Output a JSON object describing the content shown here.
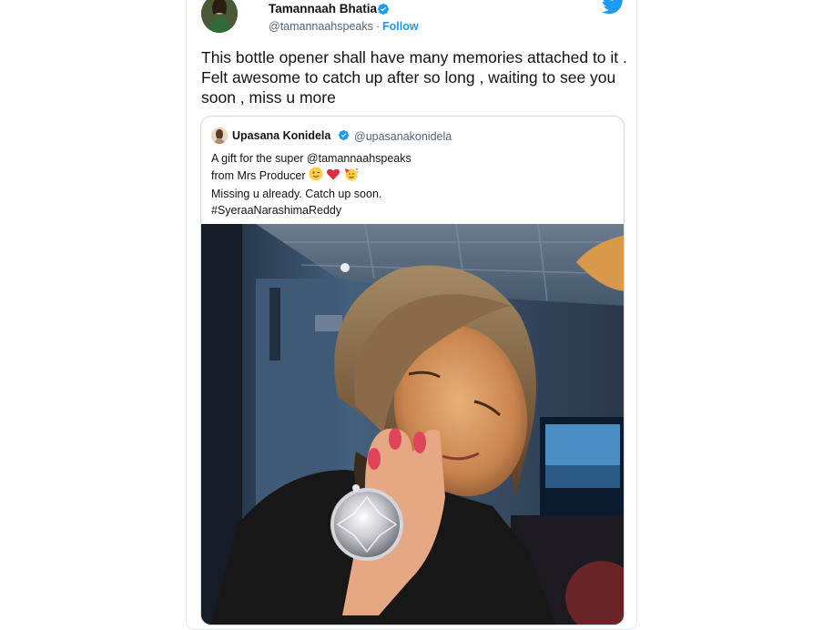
{
  "tweet": {
    "author_name": "Tamannaah Bhatia",
    "author_handle": "@tamannaahspeaks",
    "separator": "·",
    "follow_label": "Follow",
    "text": "This bottle opener shall have many memories attached to it . Felt awesome to catch up after so long , waiting to see you soon , miss u more"
  },
  "quoted_tweet": {
    "author_name": "Upasana Konidela",
    "author_handle": "@upasanakonidela",
    "lines": [
      "A  gift for the super @tamannaahspeaks",
      "from Mrs Producer",
      "Missing u already. Catch up soon.",
      "#SyeraaNarashimaReddy"
    ]
  },
  "icons": {
    "brand": "twitter-bird-icon",
    "verified": "verified-badge-icon",
    "emoji": [
      "wink-face-emoji",
      "red-heart-emoji",
      "party-face-emoji"
    ]
  },
  "colors": {
    "accent": "#1d9bf0",
    "text": "#0f1419",
    "muted": "#536471",
    "border": "#cfd9de"
  }
}
